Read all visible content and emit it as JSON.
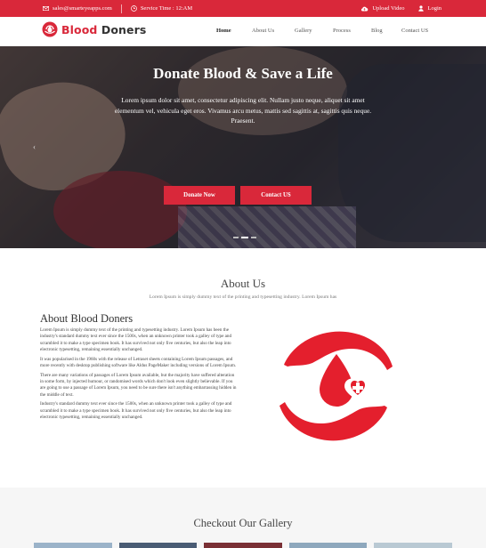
{
  "topbar": {
    "email": "sales@smarteyeapps.com",
    "service": "Service Time : 12:AM",
    "upload": "Upload Video",
    "login": "Login"
  },
  "brand": {
    "word1": "Blood",
    "word2": "Doners"
  },
  "nav": [
    "Home",
    "About Us",
    "Gallery",
    "Process",
    "Blog",
    "Contact US"
  ],
  "hero": {
    "title": "Donate Blood & Save a Life",
    "text": "Lorem ipsum dolor sit amet, consectetur adipiscing elit. Nullam justo neque, aliquet sit amet elementum vel, vehicula eget eros. Vivamus arcu metus, mattis sed sagittis at, sagittis quis neque. Praesent.",
    "btn_donate": "Donate Now",
    "btn_contact": "Contact US"
  },
  "about": {
    "heading": "About Us",
    "subheading": "Lorem Ipsum is simply dummy text of the printing and typesetting industry. Lorem Ipsum has",
    "title": "About Blood Doners",
    "paragraphs": [
      "Lorem Ipsum is simply dummy text of the printing and typesetting industry. Lorem Ipsum has been the industry's standard dummy text ever since the 1500s, when an unknown printer took a galley of type and scrambled it to make a type specimen book. It has survived not only five centuries, but also the leap into electronic typesetting, remaining essentially unchanged.",
      "It was popularised in the 1960s with the release of Letraset sheets containing Lorem Ipsum passages, and more recently with desktop publishing software like Aldus PageMaker including versions of Lorem Ipsum.",
      "There are many variations of passages of Lorem Ipsum available, but the majority have suffered alteration in some form, by injected humour, or randomised words which don't look even slightly believable. If you are going to use a passage of Lorem Ipsum, you need to be sure there isn't anything embarrassing hidden in the middle of text.",
      "Industry's standard dummy text ever since the 1500s, when an unknown printer took a galley of type and scrambled it to make a type specimen book. It has survived not only five centuries, but also the leap into electronic typesetting, remaining essentially unchanged."
    ]
  },
  "gallery": {
    "heading": "Checkout Our Gallery"
  },
  "colors": {
    "accent": "#d9283a",
    "topbar": "#d9283a",
    "gallery_bg": "#f6f6f6"
  }
}
